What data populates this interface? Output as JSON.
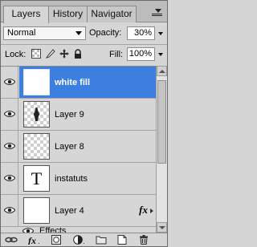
{
  "tabs": [
    {
      "label": "Layers",
      "active": true
    },
    {
      "label": "History",
      "active": false
    },
    {
      "label": "Navigator",
      "active": false
    }
  ],
  "blend_mode": {
    "selected": "Normal"
  },
  "opacity": {
    "label": "Opacity:",
    "value": "30%"
  },
  "lock": {
    "label": "Lock:",
    "icons": [
      "lock-transparent-pixels-icon",
      "lock-image-pixels-icon",
      "lock-position-icon",
      "lock-all-icon"
    ]
  },
  "fill": {
    "label": "Fill:",
    "value": "100%"
  },
  "layers": [
    {
      "name": "white fill",
      "selected": true,
      "thumb": "white-dotted"
    },
    {
      "name": "Layer 9",
      "selected": false,
      "thumb": "transparent-with-figure"
    },
    {
      "name": "Layer 8",
      "selected": false,
      "thumb": "transparent"
    },
    {
      "name": "instatuts",
      "selected": false,
      "thumb": "text",
      "thumb_glyph": "T"
    },
    {
      "name": "Layer 4",
      "selected": false,
      "thumb": "white",
      "fx": "fx"
    }
  ],
  "effects": {
    "label": "Effects"
  },
  "bottom_icons": [
    "link-layers-icon",
    "add-layer-style-icon",
    "add-layer-mask-icon",
    "new-adjustment-layer-icon",
    "new-group-icon",
    "new-layer-icon",
    "delete-layer-icon"
  ],
  "colors": {
    "selection": "#3d7fe0",
    "panel_bg": "#d6d6d6"
  }
}
